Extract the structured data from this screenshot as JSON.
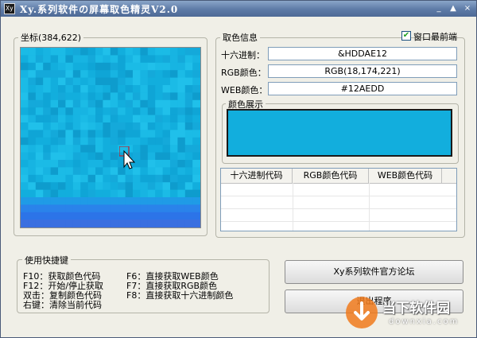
{
  "window": {
    "title": "Xy.系列软件の屏幕取色精灵V2.0",
    "app_icon": "Xy"
  },
  "titlebar": {
    "minimize": "_",
    "maximize": "▲",
    "close": "×"
  },
  "coord": {
    "label": "坐标(384,622)"
  },
  "color_info": {
    "label": "取色信息",
    "topmost_label": "窗口最前端",
    "topmost_checked": true,
    "hex_label": "十六进制：",
    "hex_value": "&HDDAE12",
    "rgb_label": "RGB颜色：",
    "rgb_value": "RGB(18,174,221)",
    "web_label": "WEB颜色：",
    "web_value": "#12AEDD",
    "preview_label": "颜色展示",
    "preview_color": "#12AEDD"
  },
  "history_table": {
    "columns": [
      "十六进制代码",
      "RGB颜色代码",
      "WEB颜色代码"
    ]
  },
  "shortcuts": {
    "label": "使用快捷键",
    "items": [
      "F10：获取颜色代码",
      "F12：开始/停止获取",
      "双击：复制颜色代码",
      "右键：清除当前代码",
      "F6：直接获取WEB颜色",
      "F7：直接获取RGB颜色",
      "F8：直接获取十六进制颜色"
    ]
  },
  "buttons": {
    "forum": "Xy系列软件官方论坛",
    "exit": "退出程序"
  },
  "watermark": {
    "name": "当下软件园",
    "url": "downxia.com"
  }
}
